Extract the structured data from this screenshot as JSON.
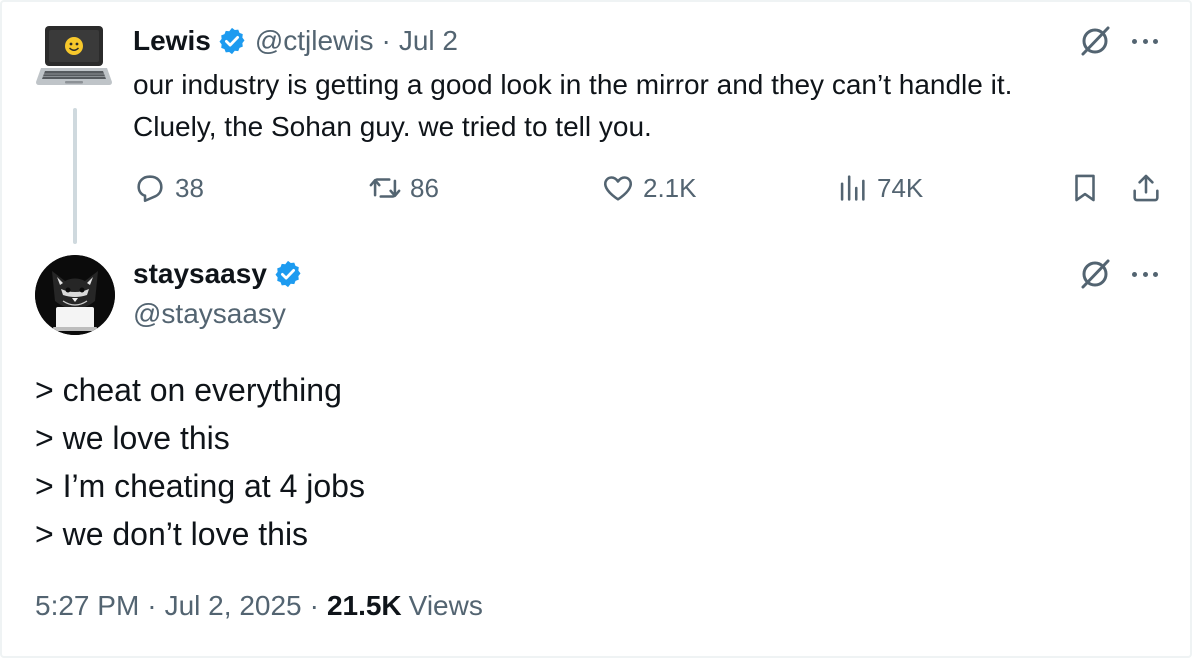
{
  "parent_tweet": {
    "avatar_icon": "laptop-emoji",
    "author_name": "Lewis",
    "verified": true,
    "handle": "@ctjlewis",
    "separator": "·",
    "date": "Jul 2",
    "text_lines": [
      "our industry is getting a good look in the mirror and they can’t handle it.",
      "Cluely, the Sohan guy. we tried to tell you."
    ],
    "metrics": {
      "replies": "38",
      "reposts": "86",
      "likes": "2.1K",
      "views": "74K"
    }
  },
  "main_tweet": {
    "author_name": "staysaasy",
    "verified": true,
    "handle": "@staysaasy",
    "body_lines": [
      "> cheat on everything",
      "> we love this",
      "> I’m cheating at 4 jobs",
      "> we don’t love this"
    ],
    "time": "5:27 PM",
    "separator": "·",
    "date": "Jul 2, 2025",
    "views_count": "21.5K",
    "views_label": "Views"
  },
  "colors": {
    "text_primary": "#0f1419",
    "text_secondary": "#536471",
    "verified_blue": "#1d9bf0",
    "thread_line": "#cfd9de"
  }
}
